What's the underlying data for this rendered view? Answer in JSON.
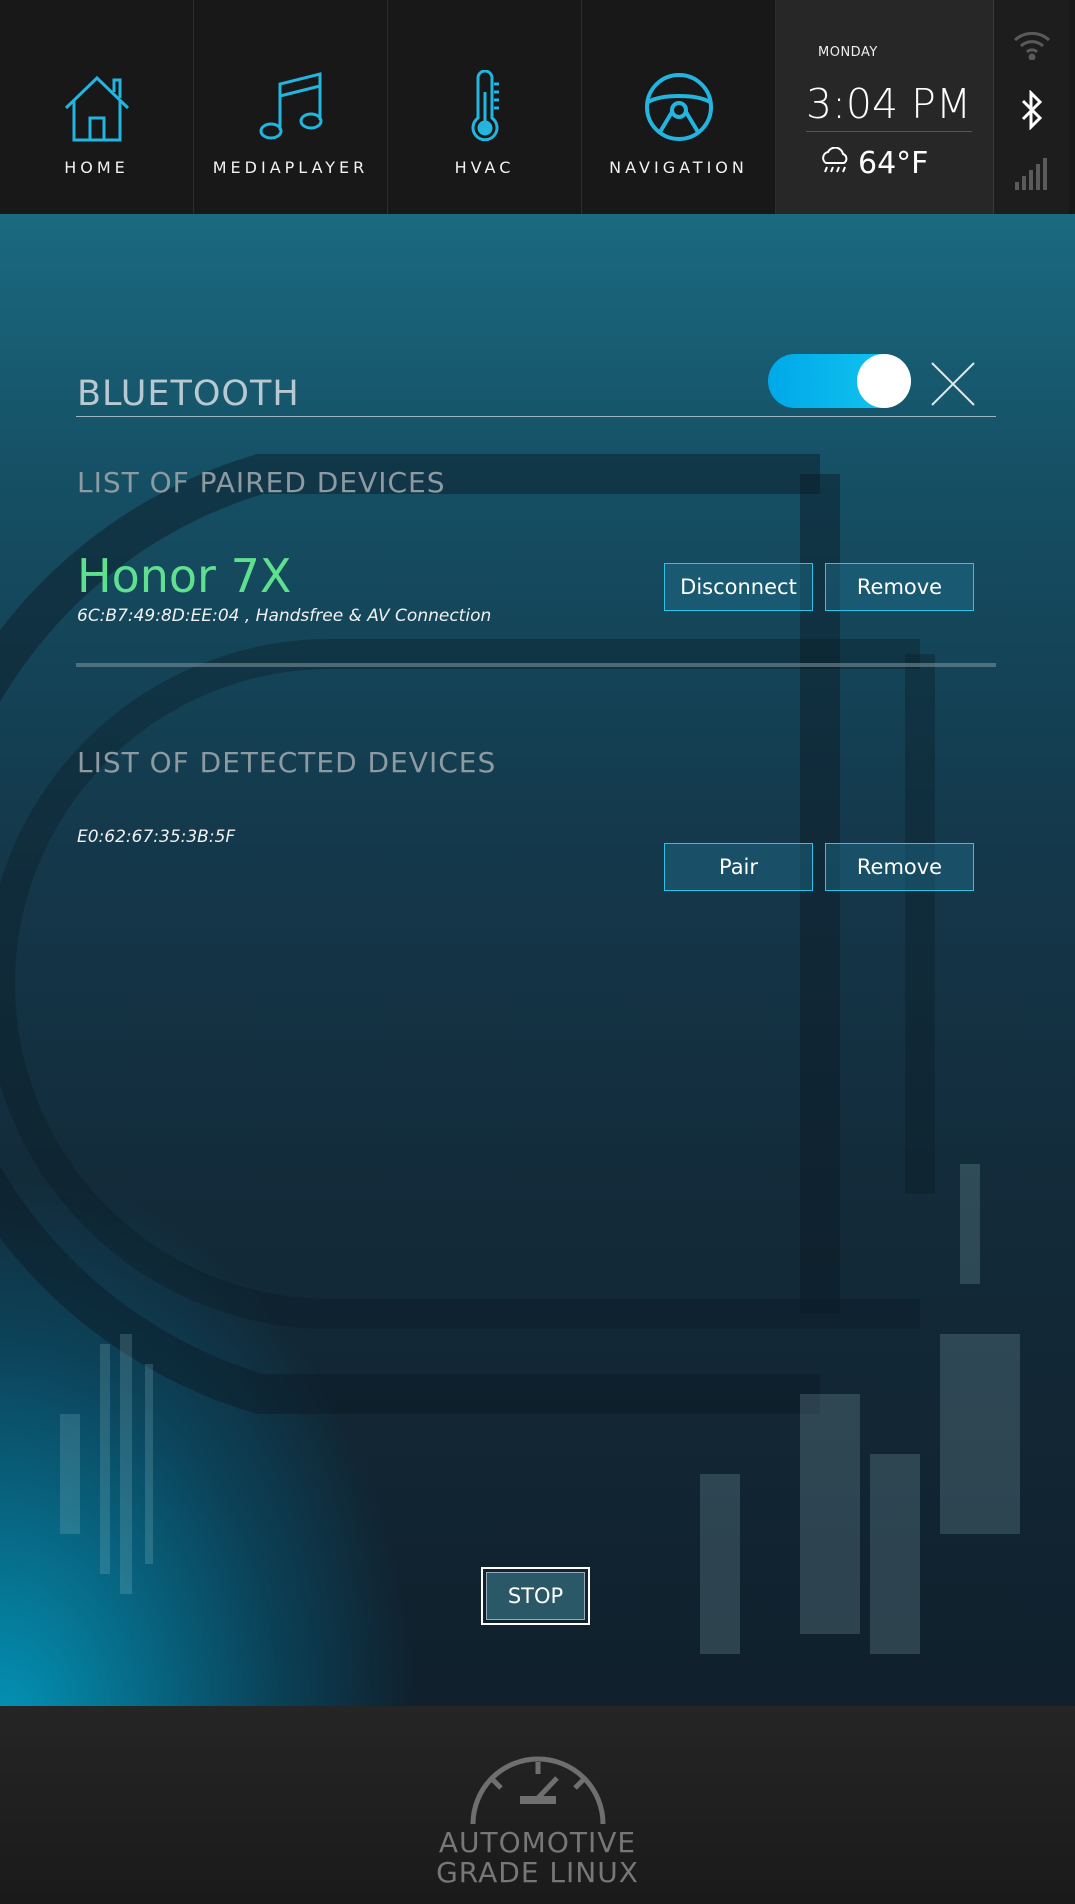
{
  "nav": {
    "items": [
      {
        "label": "HOME",
        "icon": "home-icon"
      },
      {
        "label": "MEDIAPLAYER",
        "icon": "music-note-icon"
      },
      {
        "label": "HVAC",
        "icon": "thermometer-icon"
      },
      {
        "label": "NAVIGATION",
        "icon": "steering-wheel-icon"
      }
    ]
  },
  "clock": {
    "day": "MONDAY",
    "time": "3:04 PM",
    "temperature": "64°F",
    "weather_icon": "rain-cloud-icon"
  },
  "status": {
    "icons": [
      "wifi-icon",
      "bluetooth-icon",
      "signal-bars-icon"
    ]
  },
  "bluetooth": {
    "title": "BLUETOOTH",
    "enabled": true,
    "paired_heading": "LIST OF PAIRED DEVICES",
    "paired": [
      {
        "name": "Honor 7X",
        "details": "6C:B7:49:8D:EE:04 , Handsfree & AV Connection",
        "primary_button": "Disconnect",
        "secondary_button": "Remove"
      }
    ],
    "detected_heading": "LIST OF DETECTED DEVICES",
    "detected": [
      {
        "address": "E0:62:67:35:3B:5F",
        "primary_button": "Pair",
        "secondary_button": "Remove"
      }
    ],
    "stop_button": "STOP"
  },
  "footer": {
    "logo_line1": "AUTOMOTIVE",
    "logo_line2": "GRADE LINUX"
  },
  "colors": {
    "accent": "#2cc3e6",
    "paired_name": "#5fe08e",
    "toggle_on": "#00a8e8"
  }
}
